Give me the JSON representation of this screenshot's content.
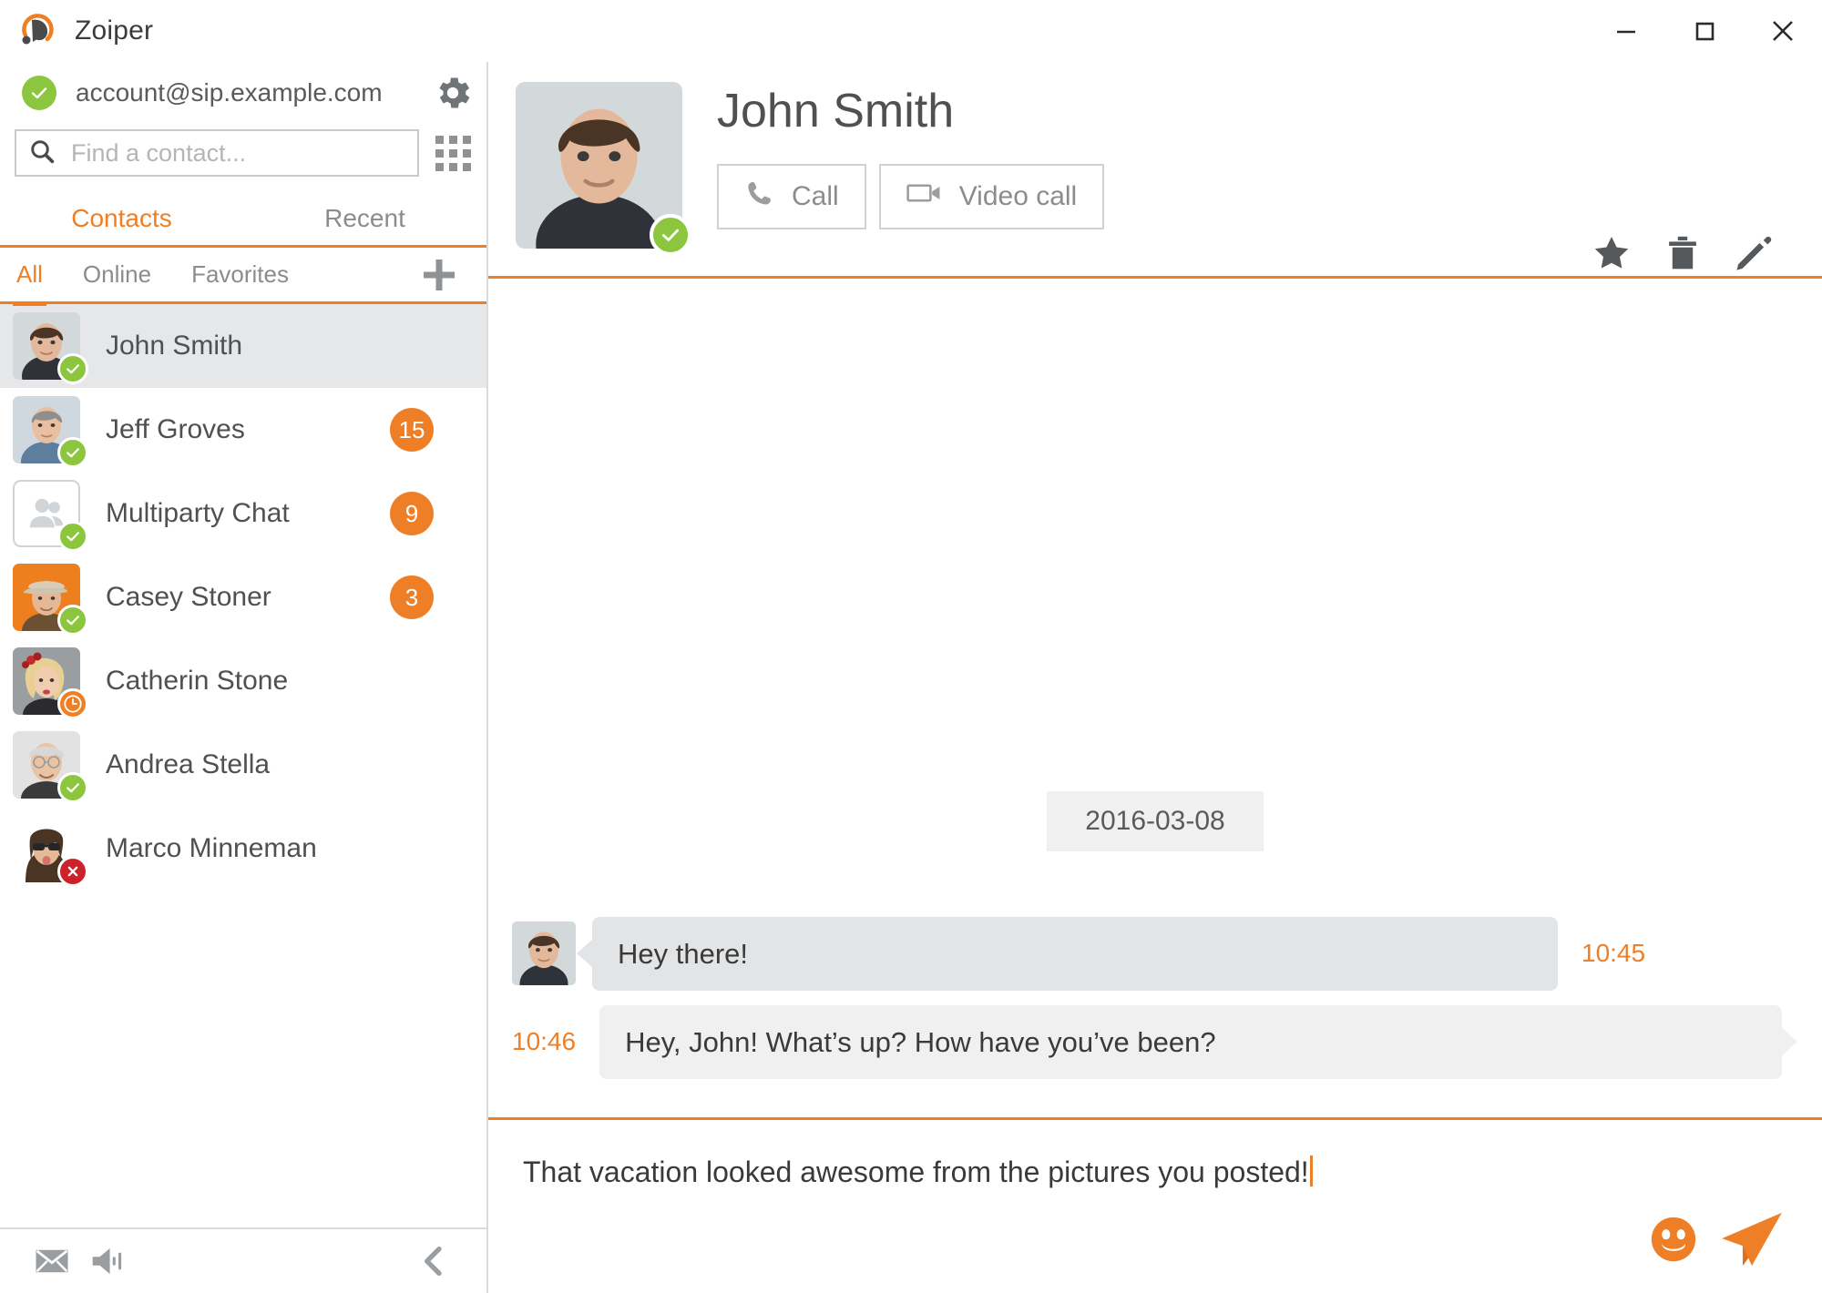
{
  "window": {
    "app_name": "Zoiper",
    "logo_icon": "zoiper-headset-logo",
    "controls": [
      {
        "name": "minimize",
        "icon": "minimize-icon"
      },
      {
        "name": "maximize",
        "icon": "maximize-icon"
      },
      {
        "name": "close",
        "icon": "close-icon"
      }
    ]
  },
  "sidebar": {
    "account": {
      "name": "account@sip.example.com",
      "status": "online",
      "status_icon": "check-circle-icon"
    },
    "settings_icon": "gear-icon",
    "dialpad_icon": "dialpad-grid-icon",
    "search": {
      "placeholder": "Find a contact...",
      "value": "",
      "icon": "search-icon"
    },
    "main_tabs": [
      {
        "label": "Contacts",
        "active": true
      },
      {
        "label": "Recent",
        "active": false
      }
    ],
    "filter_tabs": [
      {
        "label": "All",
        "active": true
      },
      {
        "label": "Online",
        "active": false
      },
      {
        "label": "Favorites",
        "active": false
      }
    ],
    "add_contact_icon": "plus-icon",
    "contacts": [
      {
        "name": "John Smith",
        "status": "online",
        "unread": "",
        "selected": true,
        "avatar": "man-dark-shirt"
      },
      {
        "name": "Jeff Groves",
        "status": "online",
        "unread": "15",
        "selected": false,
        "avatar": "man-blue-shirt"
      },
      {
        "name": "Multiparty Chat",
        "status": "online",
        "unread": "9",
        "selected": false,
        "avatar": "group-icon"
      },
      {
        "name": "Casey Stoner",
        "status": "online",
        "unread": "3",
        "selected": false,
        "avatar": "man-cap-orange"
      },
      {
        "name": "Catherin Stone",
        "status": "away",
        "unread": "",
        "selected": false,
        "avatar": "woman-blonde-flower"
      },
      {
        "name": "Andrea Stella",
        "status": "online",
        "unread": "",
        "selected": false,
        "avatar": "elderly-man-glasses"
      },
      {
        "name": "Marco Minneman",
        "status": "offline",
        "unread": "",
        "selected": false,
        "avatar": "person-sunglasses"
      }
    ],
    "footer": [
      {
        "name": "voicemail",
        "icon": "envelope-icon"
      },
      {
        "name": "volume",
        "icon": "speaker-icon"
      },
      {
        "name": "collapse-panel",
        "icon": "chevron-left-icon"
      }
    ]
  },
  "chat": {
    "header": {
      "contact_name": "John Smith",
      "status": "online",
      "status_icon": "check-circle-icon",
      "avatar": "man-dark-shirt",
      "call_button": {
        "label": "Call",
        "icon": "phone-icon"
      },
      "video_call_button": {
        "label": "Video call",
        "icon": "video-camera-icon"
      },
      "actions": [
        {
          "name": "favorite",
          "icon": "star-icon"
        },
        {
          "name": "delete",
          "icon": "trash-icon"
        },
        {
          "name": "edit",
          "icon": "pencil-icon"
        }
      ]
    },
    "date_separator": "2016-03-08",
    "messages": [
      {
        "direction": "incoming",
        "sender": "John Smith",
        "text": "Hey there!",
        "time": "10:45",
        "avatar": "man-dark-shirt"
      },
      {
        "direction": "outgoing",
        "sender": "me",
        "text": "Hey, John! What’s up? How have you’ve been?",
        "time": "10:46",
        "avatar": ""
      }
    ],
    "composer": {
      "value": "That vacation looked awesome from the pictures you posted!",
      "placeholder": "",
      "emoji_icon": "smiley-icon",
      "send_icon": "send-paper-plane-icon"
    }
  },
  "colors": {
    "accent": "#f07f24",
    "online": "#8cc63e",
    "away": "#f07f24",
    "offline": "#cc2229",
    "badge": "#ef7f27",
    "text": "#4e5052",
    "muted": "#8a8d8f",
    "bubble_in": "#e3e4e5",
    "bubble_out": "#f0f0f0",
    "selected_row": "#e5e7e9"
  }
}
